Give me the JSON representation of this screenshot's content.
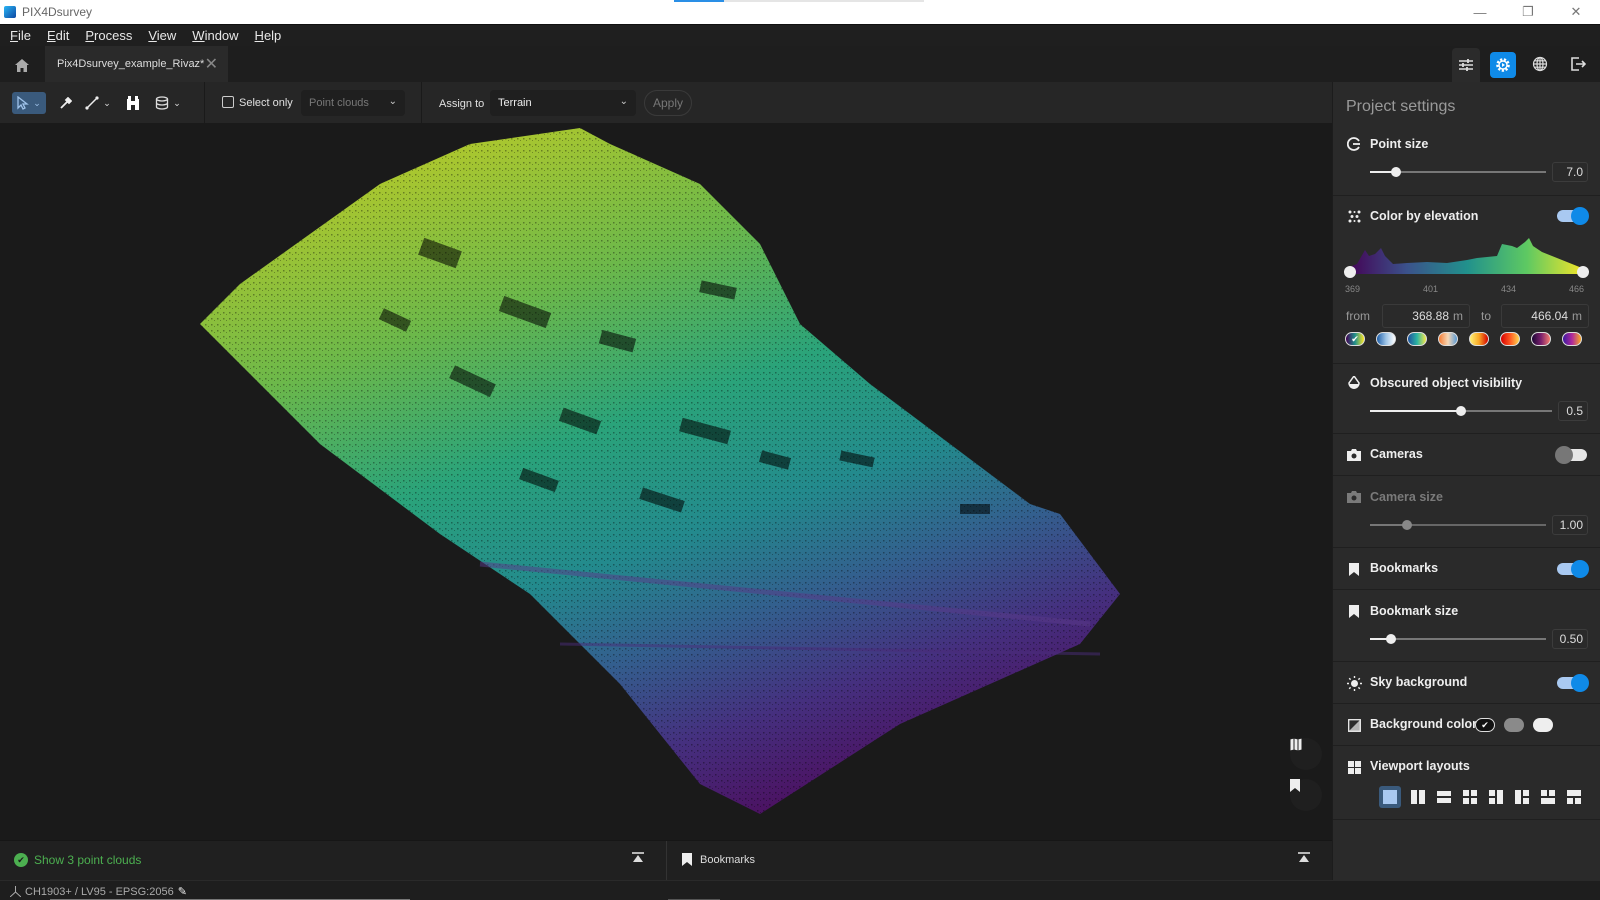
{
  "window": {
    "app_title": "PIX4Dsurvey",
    "minimize_icon": "minimize-icon",
    "restore_icon": "restore-icon",
    "close_icon": "close-icon"
  },
  "menu": [
    {
      "label": "File",
      "mnemonic": "F",
      "rest": "ile"
    },
    {
      "label": "Edit",
      "mnemonic": "E",
      "rest": "dit"
    },
    {
      "label": "Process",
      "mnemonic": "P",
      "rest": "rocess"
    },
    {
      "label": "View",
      "mnemonic": "V",
      "rest": "iew"
    },
    {
      "label": "Window",
      "mnemonic": "W",
      "rest": "indow"
    },
    {
      "label": "Help",
      "mnemonic": "H",
      "rest": "elp"
    }
  ],
  "tabs": {
    "project_tab": "Pix4Dsurvey_example_Rivaz*",
    "close_glyph": "✕",
    "home_icon": "home-icon"
  },
  "right_tools": [
    "sliders-icon",
    "settings-icon",
    "globe-icon",
    "export-icon"
  ],
  "toolbar": {
    "select_only_label": "Select only",
    "select_only_checked": false,
    "select_source": "Point clouds",
    "assign_to_label": "Assign to",
    "assign_to_value": "Terrain",
    "apply_label": "Apply"
  },
  "viewport": {
    "map_button_icon": "map-icon",
    "bookmark_button_icon": "bookmark-icon"
  },
  "bottom": {
    "point_clouds_label": "Show 3 point clouds",
    "bookmarks_label": "Bookmarks"
  },
  "status": {
    "crs": "CH1903+ / LV95 - EPSG:2056"
  },
  "panel": {
    "title": "Project settings",
    "point_size": {
      "label": "Point size",
      "value": "7.0",
      "fraction": 0.15
    },
    "color_by_elevation": {
      "label": "Color by elevation",
      "enabled": true,
      "ticks": [
        "369",
        "401",
        "434",
        "466"
      ],
      "from_label": "from",
      "to_label": "to",
      "from_value": "368.88",
      "to_value": "466.04",
      "unit": "m",
      "palettes": [
        {
          "name": "viridis",
          "selected": true,
          "colors": [
            "#440154",
            "#21918c",
            "#fde725"
          ]
        },
        {
          "name": "blues",
          "selected": false,
          "colors": [
            "#1f5fa8",
            "#9cc3e6",
            "#ffffff"
          ]
        },
        {
          "name": "blue-green-yellow",
          "selected": false,
          "colors": [
            "#1f4f9e",
            "#2bb3a3",
            "#f5e84a"
          ]
        },
        {
          "name": "orange-blue",
          "selected": false,
          "colors": [
            "#f57c33",
            "#f7d7b5",
            "#5b9bd5"
          ]
        },
        {
          "name": "yellow-red",
          "selected": false,
          "colors": [
            "#fff176",
            "#f9a825",
            "#d50000"
          ]
        },
        {
          "name": "red-yellow",
          "selected": false,
          "colors": [
            "#d50000",
            "#ff5722",
            "#ffd54f"
          ]
        },
        {
          "name": "magma",
          "selected": false,
          "colors": [
            "#1a0833",
            "#7a1f6d",
            "#f57c6e"
          ]
        },
        {
          "name": "plasma",
          "selected": false,
          "colors": [
            "#3a1ba0",
            "#b0289c",
            "#f9a825"
          ]
        }
      ]
    },
    "obscured_visibility": {
      "label": "Obscured object visibility",
      "value": "0.5",
      "fraction": 0.5
    },
    "cameras": {
      "label": "Cameras",
      "enabled": false
    },
    "camera_size": {
      "label": "Camera size",
      "value": "1.00",
      "fraction": 0.21
    },
    "bookmarks": {
      "label": "Bookmarks",
      "enabled": true
    },
    "bookmark_size": {
      "label": "Bookmark size",
      "value": "0.50",
      "fraction": 0.12
    },
    "sky_background": {
      "label": "Sky background",
      "enabled": true
    },
    "background_color": {
      "label": "Background color",
      "options": [
        "#111111",
        "#8a8a8a",
        "#eeeeee"
      ],
      "selected": 0
    },
    "viewport_layouts": {
      "label": "Viewport layouts",
      "options": [
        "single",
        "two-vertical",
        "two-horizontal",
        "four-grid",
        "three-left",
        "three-right",
        "three-top",
        "three-bottom"
      ],
      "selected": 0
    }
  },
  "colors": {
    "accent": "#0f8ae8",
    "success": "#4caf50",
    "panel_bg": "#2a2a2a",
    "viewport_bg": "#1a1a1a"
  }
}
